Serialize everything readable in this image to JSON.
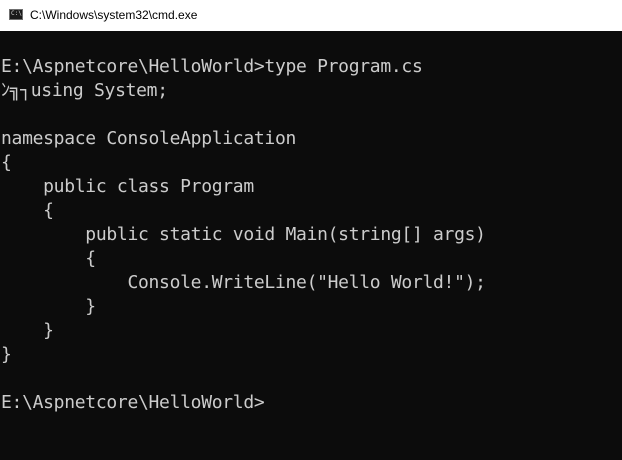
{
  "window": {
    "title": "C:\\Windows\\system32\\cmd.exe",
    "icon": "cmd-console-icon",
    "icon_glyph": "C:\\"
  },
  "console": {
    "lines": [
      "E:\\Aspnetcore\\HelloWorld>type Program.cs",
      "ﾝ╗┐using System;",
      "",
      "namespace ConsoleApplication",
      "{",
      "    public class Program",
      "    {",
      "        public static void Main(string[] args)",
      "        {",
      "            Console.WriteLine(\"Hello World!\");",
      "        }",
      "    }",
      "}",
      "",
      "E:\\Aspnetcore\\HelloWorld>"
    ]
  },
  "colors": {
    "console_background": "#0c0c0c",
    "console_text": "#cccccc",
    "titlebar_background": "#ffffff"
  }
}
